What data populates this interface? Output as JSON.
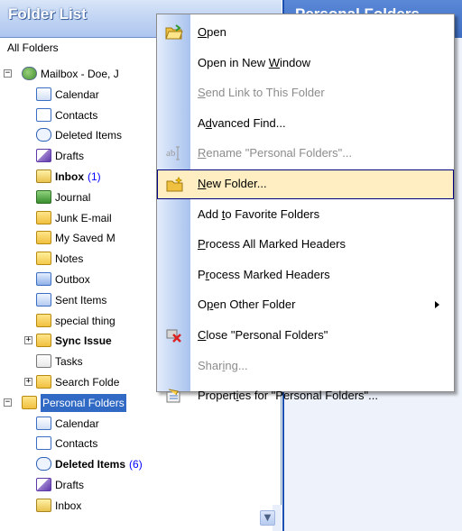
{
  "pane": {
    "title": "Folder List",
    "dropdown": "All Folders",
    "right_title": "Personal Folders"
  },
  "tree": [
    {
      "label": "Mailbox - Doe, J",
      "icon": "mailbox-icon",
      "bold": false,
      "count": "",
      "expander": "−",
      "indent": 1
    },
    {
      "label": "Calendar",
      "icon": "calendar-icon",
      "bold": false,
      "count": "",
      "indent": 2
    },
    {
      "label": "Contacts",
      "icon": "contacts-icon",
      "bold": false,
      "count": "",
      "indent": 2
    },
    {
      "label": "Deleted Items",
      "icon": "deleted-items-icon",
      "bold": false,
      "count": "",
      "indent": 2
    },
    {
      "label": "Drafts",
      "icon": "drafts-icon",
      "bold": false,
      "count": "",
      "indent": 2
    },
    {
      "label": "Inbox",
      "icon": "inbox-icon",
      "bold": true,
      "count": "(1)",
      "indent": 2
    },
    {
      "label": "Journal",
      "icon": "journal-icon",
      "bold": false,
      "count": "",
      "indent": 2
    },
    {
      "label": "Junk E-mail",
      "icon": "junk-email-icon",
      "bold": false,
      "count": "",
      "indent": 2
    },
    {
      "label": "My Saved M",
      "icon": "folder-icon",
      "bold": false,
      "count": "",
      "indent": 2
    },
    {
      "label": "Notes",
      "icon": "notes-icon",
      "bold": false,
      "count": "",
      "indent": 2
    },
    {
      "label": "Outbox",
      "icon": "outbox-icon",
      "bold": false,
      "count": "",
      "indent": 2
    },
    {
      "label": "Sent Items",
      "icon": "sent-items-icon",
      "bold": false,
      "count": "",
      "indent": 2
    },
    {
      "label": "special thing",
      "icon": "folder-icon",
      "bold": false,
      "count": "",
      "indent": 2
    },
    {
      "label": "Sync Issue",
      "icon": "folder-icon",
      "bold": true,
      "count": "",
      "expander": "+",
      "indent": 2
    },
    {
      "label": "Tasks",
      "icon": "tasks-icon",
      "bold": false,
      "count": "",
      "indent": 2
    },
    {
      "label": "Search Folde",
      "icon": "search-folder-icon",
      "bold": false,
      "count": "",
      "expander": "+",
      "indent": 2
    },
    {
      "label": "Personal Folders",
      "icon": "personal-folders-icon",
      "bold": false,
      "count": "",
      "expander": "−",
      "indent": 1,
      "selected": true
    },
    {
      "label": "Calendar",
      "icon": "calendar-icon",
      "bold": false,
      "count": "",
      "indent": 2
    },
    {
      "label": "Contacts",
      "icon": "contacts-icon",
      "bold": false,
      "count": "",
      "indent": 2
    },
    {
      "label": "Deleted Items",
      "icon": "deleted-items-icon",
      "bold": true,
      "count": "(6)",
      "indent": 2
    },
    {
      "label": "Drafts",
      "icon": "drafts-icon",
      "bold": false,
      "count": "",
      "indent": 2
    },
    {
      "label": "Inbox",
      "icon": "inbox-icon",
      "bold": false,
      "count": "",
      "indent": 2
    }
  ],
  "menu": {
    "items": [
      {
        "label": "Open",
        "accel": "O",
        "icon": "open-folder-icon",
        "disabled": false,
        "hover": false,
        "submenu": false
      },
      {
        "label": "Open in New Window",
        "accel": "W",
        "icon": "",
        "disabled": false,
        "hover": false,
        "submenu": false
      },
      {
        "label": "Send Link to This Folder",
        "accel": "S",
        "icon": "",
        "disabled": true,
        "hover": false,
        "submenu": false
      },
      {
        "label": "Advanced Find...",
        "accel": "d",
        "icon": "",
        "disabled": false,
        "hover": false,
        "submenu": false
      },
      {
        "label": "Rename \"Personal Folders\"...",
        "accel": "R",
        "icon": "rename-icon",
        "disabled": true,
        "hover": false,
        "submenu": false
      },
      {
        "label": "New Folder...",
        "accel": "N",
        "icon": "new-folder-icon",
        "disabled": false,
        "hover": true,
        "submenu": false
      },
      {
        "label": "Add to Favorite Folders",
        "accel": "t",
        "icon": "",
        "disabled": false,
        "hover": false,
        "submenu": false
      },
      {
        "label": "Process All Marked Headers",
        "accel": "P",
        "icon": "",
        "disabled": false,
        "hover": false,
        "submenu": false
      },
      {
        "label": "Process Marked Headers",
        "accel": "r",
        "icon": "",
        "disabled": false,
        "hover": false,
        "submenu": false
      },
      {
        "label": "Open Other Folder",
        "accel": "p",
        "icon": "",
        "disabled": false,
        "hover": false,
        "submenu": true
      },
      {
        "label": "Close \"Personal Folders\"",
        "accel": "C",
        "icon": "close-folder-icon",
        "disabled": false,
        "hover": false,
        "submenu": false
      },
      {
        "label": "Sharing...",
        "accel": "i",
        "icon": "",
        "disabled": true,
        "hover": false,
        "submenu": false
      },
      {
        "label": "Properties for \"Personal Folders\"...",
        "accel": "i",
        "icon": "properties-icon",
        "disabled": false,
        "hover": false,
        "submenu": false
      }
    ]
  },
  "colors": {
    "selection": "#316ac5",
    "unread_count": "#0000ff",
    "menu_hover": "#ffeec2",
    "menu_hover_border": "#000080"
  }
}
